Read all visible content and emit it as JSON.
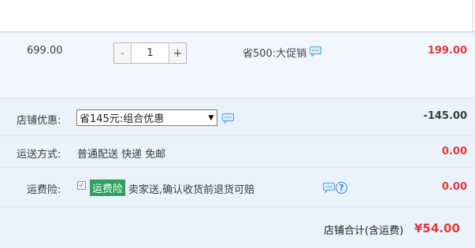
{
  "item": {
    "unit_price": "699.00",
    "quantity": {
      "minus_label": "-",
      "value": "1",
      "plus_label": "+"
    },
    "promotion": "省500:大促销",
    "subtotal": "199.00"
  },
  "shop_discount": {
    "label": "店铺优惠:",
    "selected_option": "省145元:组合优惠",
    "amount": "-145.00"
  },
  "delivery": {
    "label": "运送方式:",
    "method": "普通配送 快递 免邮",
    "amount": "0.00"
  },
  "shipping_insurance": {
    "label": "运费险:",
    "checked": true,
    "badge": "运费险",
    "description": "卖家送,确认收货前退货可赔",
    "amount": "0.00",
    "help_symbol": "?"
  },
  "shop_total": {
    "label": "店铺合计(含运费)",
    "value": "¥54.00"
  },
  "colors": {
    "price_red": "#e4393c",
    "link_blue": "#2f7fd1",
    "insurance_green": "#2f9e5e",
    "row_bg": "#eaf2fc"
  },
  "icons": {
    "message": "message-bubble-icon",
    "help": "question-circle-icon",
    "dropdown": "triangle-down-icon",
    "check": "checkmark-icon"
  }
}
